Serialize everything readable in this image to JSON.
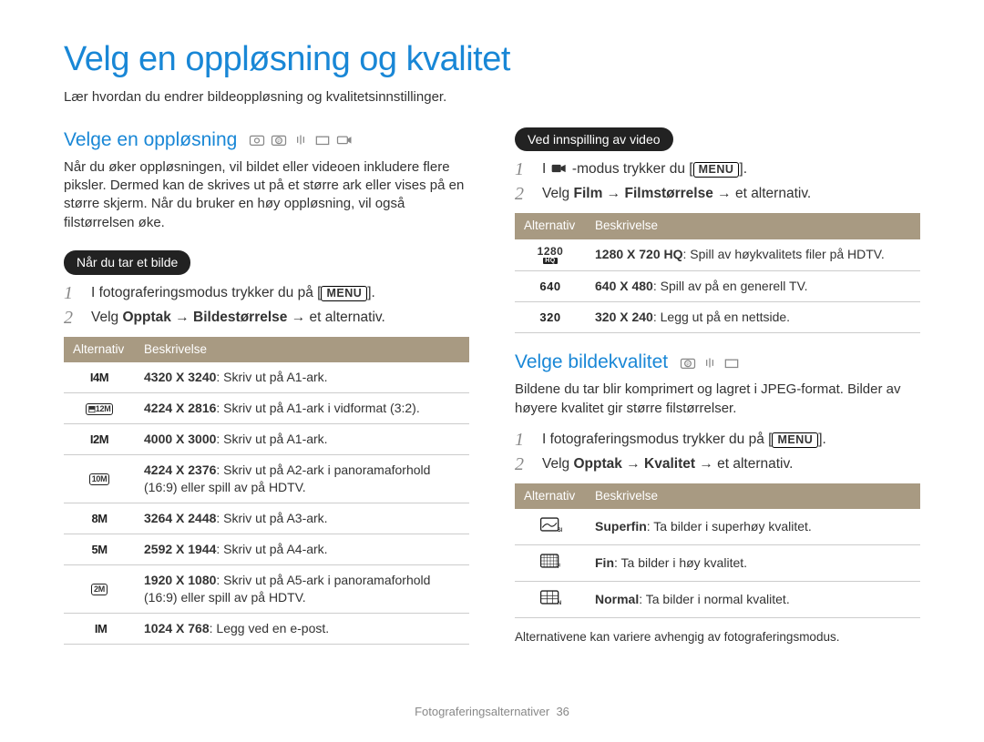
{
  "title": "Velg en oppløsning og kvalitet",
  "subtitle": "Lær hvordan du endrer bildeoppløsning og kvalitetsinnstillinger.",
  "left": {
    "heading": "Velge en oppløsning",
    "intro": "Når du øker oppløsningen, vil bildet eller videoen inkludere flere piksler. Dermed kan de skrives ut på et større ark eller vises på en større skjerm. Når du bruker en høy oppløsning, vil også filstørrelsen øke.",
    "pill": "Når du tar et bilde",
    "step1_pre": "I fotograferingsmodus trykker du på [",
    "step1_btn": "MENU",
    "step1_post": "].",
    "step2_pre": "Velg ",
    "step2_b1": "Opptak",
    "step2_arrow1": " → ",
    "step2_b2": "Bildestørrelse",
    "step2_post": " → et alternativ.",
    "th_alt": "Alternativ",
    "th_desc": "Beskrivelse",
    "rows": [
      {
        "icon": "14m",
        "b": "4320 X 3240",
        "t": ": Skriv ut på A1-ark."
      },
      {
        "icon": "w12m",
        "b": "4224 X 2816",
        "t": ": Skriv ut på A1-ark i vidformat (3:2)."
      },
      {
        "icon": "12m",
        "b": "4000 X 3000",
        "t": ": Skriv ut på A1-ark."
      },
      {
        "icon": "w10m",
        "b": "4224 X 2376",
        "t": ": Skriv ut på A2-ark i panoramaforhold (16:9) eller spill av på HDTV."
      },
      {
        "icon": "8m",
        "b": "3264 X 2448",
        "t": ": Skriv ut på A3-ark."
      },
      {
        "icon": "5m",
        "b": "2592 X 1944",
        "t": ": Skriv ut på A4-ark."
      },
      {
        "icon": "w2m",
        "b": "1920 X 1080",
        "t": ": Skriv ut på A5-ark i panoramaforhold (16:9) eller spill av på HDTV."
      },
      {
        "icon": "1m",
        "b": "1024 X 768",
        "t": ": Legg ved en e-post."
      }
    ]
  },
  "right": {
    "sec1": {
      "pill": "Ved innspilling av video",
      "step1_pre": "I ",
      "step1_mid": " -modus trykker du [",
      "step1_btn": "MENU",
      "step1_post": "].",
      "step2_pre": "Velg ",
      "step2_b1": "Film",
      "step2_arrow1": " → ",
      "step2_b2": "Filmstørrelse",
      "step2_post": " → et alternativ.",
      "th_alt": "Alternativ",
      "th_desc": "Beskrivelse",
      "rows": [
        {
          "icon": "1280hq",
          "b": "1280 X 720 HQ",
          "t": ": Spill av høykvalitets filer på HDTV."
        },
        {
          "icon": "640",
          "b": "640 X 480",
          "t": ": Spill av på en generell TV."
        },
        {
          "icon": "320",
          "b": "320 X 240",
          "t": ": Legg ut på en nettside."
        }
      ]
    },
    "sec2": {
      "heading": "Velge bildekvalitet",
      "intro": "Bildene du tar blir komprimert og lagret i JPEG-format. Bilder av høyere kvalitet gir større filstørrelser.",
      "step1_pre": "I fotograferingsmodus trykker du på [",
      "step1_btn": "MENU",
      "step1_post": "].",
      "step2_pre": "Velg ",
      "step2_b1": "Opptak",
      "step2_arrow1": " → ",
      "step2_b2": "Kvalitet",
      "step2_post": " → et alternativ.",
      "th_alt": "Alternativ",
      "th_desc": "Beskrivelse",
      "rows": [
        {
          "icon": "sf",
          "b": "Superfin",
          "t": ": Ta bilder i superhøy kvalitet."
        },
        {
          "icon": "f",
          "b": "Fin",
          "t": ": Ta bilder i høy kvalitet."
        },
        {
          "icon": "n",
          "b": "Normal",
          "t": ": Ta bilder i normal kvalitet."
        }
      ],
      "note": "Alternativene kan variere avhengig av fotograferingsmodus."
    }
  },
  "footer_label": "Fotograferingsalternativer",
  "footer_page": "36"
}
